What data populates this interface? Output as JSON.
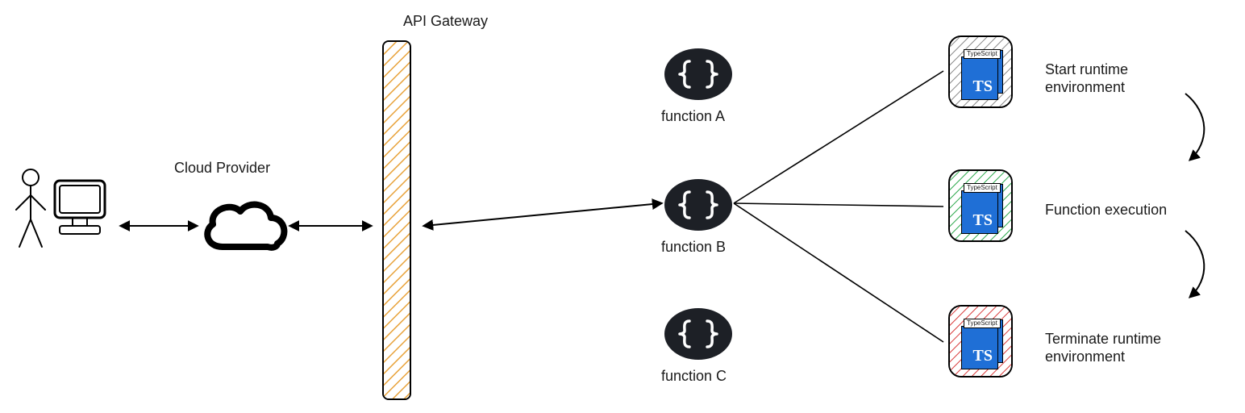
{
  "title_api_gateway": "API Gateway",
  "title_cloud_provider": "Cloud Provider",
  "functions": {
    "a": "function A",
    "b": "function B",
    "c": "function C"
  },
  "runtime": {
    "start": "Start runtime\nenvironment",
    "exec": "Function execution",
    "terminate": "Terminate runtime\nenvironment"
  },
  "ts": {
    "chip": "TypeScript",
    "abbrev": "TS"
  },
  "colors": {
    "gateway_hatch": "#e8a23a",
    "brace_bg": "#1d2026",
    "ts_blue": "#1f6fd6",
    "start_hatch": "#888888",
    "exec_hatch": "#2aa84a",
    "terminate_hatch": "#d93a3a"
  }
}
